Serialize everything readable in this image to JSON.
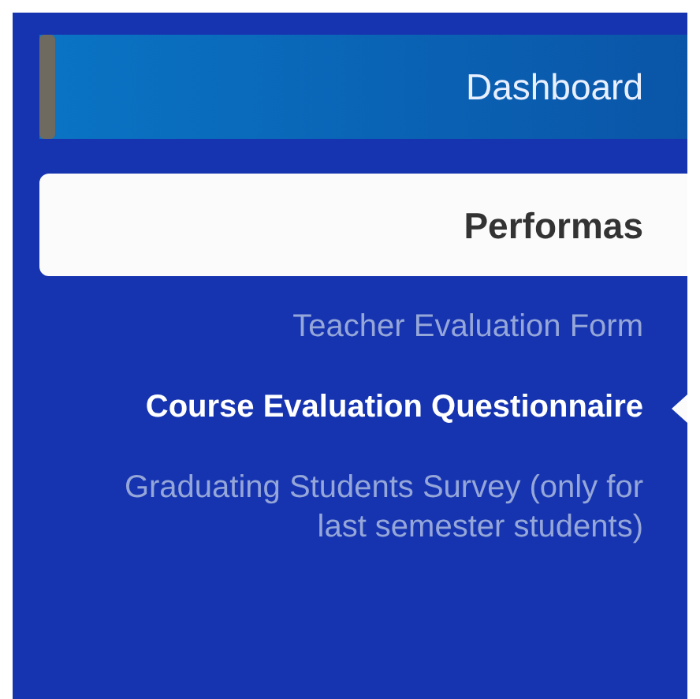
{
  "sidebar": {
    "items": [
      {
        "kind": "link",
        "label": "Dashboard"
      },
      {
        "kind": "section",
        "label": "Performas",
        "children": [
          {
            "label": "Teacher Evaluation Form",
            "selected": false
          },
          {
            "label": "Course Evaluation Questionnaire",
            "selected": true
          },
          {
            "label": "Graduating Students Survey (only for last semester students)",
            "selected": false
          }
        ]
      }
    ]
  }
}
